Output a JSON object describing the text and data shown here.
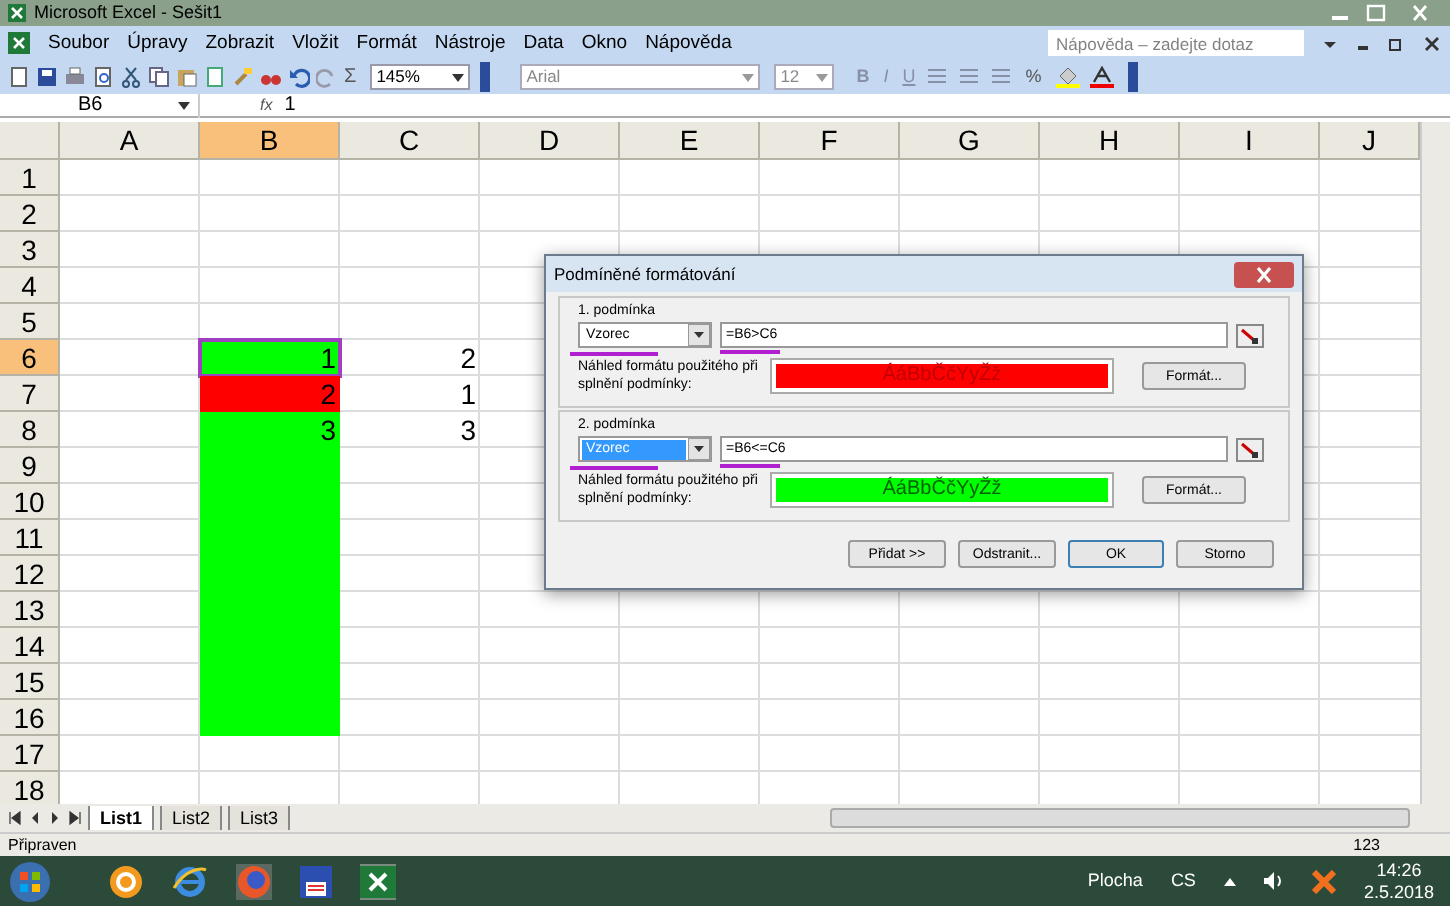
{
  "window": {
    "title": "Microsoft Excel - Sešit1"
  },
  "menu": [
    "Soubor",
    "Úpravy",
    "Zobrazit",
    "Vložit",
    "Formát",
    "Nástroje",
    "Data",
    "Okno",
    "Nápověda"
  ],
  "help_box": {
    "placeholder": "Nápověda – zadejte dotaz"
  },
  "toolbar": {
    "zoom": "145%",
    "font": "Arial",
    "font_size": "12",
    "sum": "Σ",
    "bold": "B",
    "italic": "I",
    "underline": "U",
    "percent": "%"
  },
  "formula_bar": {
    "name_box": "B6",
    "fx": "fx",
    "value": "1"
  },
  "columns": [
    {
      "label": "A",
      "selected": false
    },
    {
      "label": "B",
      "selected": true
    },
    {
      "label": "C",
      "selected": false
    },
    {
      "label": "D",
      "selected": false
    },
    {
      "label": "E",
      "selected": false
    },
    {
      "label": "F",
      "selected": false
    },
    {
      "label": "G",
      "selected": false
    },
    {
      "label": "H",
      "selected": false
    },
    {
      "label": "I",
      "selected": false
    },
    {
      "label": "J",
      "selected": false
    }
  ],
  "rows": [
    {
      "label": "1",
      "selected": false,
      "cells": []
    },
    {
      "label": "2",
      "selected": false,
      "cells": []
    },
    {
      "label": "3",
      "selected": false,
      "cells": []
    },
    {
      "label": "4",
      "selected": false,
      "cells": []
    },
    {
      "label": "5",
      "selected": false,
      "cells": []
    },
    {
      "label": "6",
      "selected": true,
      "cells": [
        {},
        {
          "value": "1",
          "color": "#00ff00",
          "selected": true
        },
        {
          "value": "2"
        }
      ]
    },
    {
      "label": "7",
      "selected": false,
      "cells": [
        {},
        {
          "value": "2",
          "color": "#ff0000"
        },
        {
          "value": "1"
        }
      ]
    },
    {
      "label": "8",
      "selected": false,
      "cells": [
        {},
        {
          "value": "3",
          "color": "#00ff00"
        },
        {
          "value": "3"
        }
      ]
    },
    {
      "label": "9",
      "selected": false,
      "cells": [
        {},
        {
          "color": "#00ff00"
        }
      ]
    },
    {
      "label": "10",
      "selected": false,
      "cells": [
        {},
        {
          "color": "#00ff00"
        }
      ]
    },
    {
      "label": "11",
      "selected": false,
      "cells": [
        {},
        {
          "color": "#00ff00"
        }
      ]
    },
    {
      "label": "12",
      "selected": false,
      "cells": [
        {},
        {
          "color": "#00ff00"
        }
      ]
    },
    {
      "label": "13",
      "selected": false,
      "cells": [
        {},
        {
          "color": "#00ff00"
        }
      ]
    },
    {
      "label": "14",
      "selected": false,
      "cells": [
        {},
        {
          "color": "#00ff00"
        }
      ]
    },
    {
      "label": "15",
      "selected": false,
      "cells": [
        {},
        {
          "color": "#00ff00"
        }
      ]
    },
    {
      "label": "16",
      "selected": false,
      "cells": [
        {},
        {
          "color": "#00ff00"
        }
      ]
    },
    {
      "label": "17",
      "selected": false,
      "cells": []
    },
    {
      "label": "18",
      "selected": false,
      "cells": []
    }
  ],
  "dialog": {
    "title": "Podmíněné formátování",
    "conditions": [
      {
        "label": "1. podmínka",
        "type": "Vzorec",
        "type_selected": false,
        "formula": "=B6>C6",
        "underlined": true,
        "preview_label": "Náhled formátu použitého při splnění podmínky:",
        "preview_text": "ÁáBbČčYyŽž",
        "color": "#ff0000",
        "format_button": "Formát..."
      },
      {
        "label": "2. podmínka",
        "type": "Vzorec",
        "type_selected": true,
        "formula": "=B6<=C6",
        "underlined": true,
        "preview_label": "Náhled formátu použitého při splnění podmínky:",
        "preview_text": "ÁáBbČčYyŽž",
        "color": "#00ff00",
        "format_button": "Formát..."
      }
    ],
    "buttons": [
      "Přidat >>",
      "Odstranit...",
      "OK",
      "Storno"
    ]
  },
  "sheet_tabs": [
    {
      "label": "List1",
      "selected": true
    },
    {
      "label": "List2",
      "selected": false
    },
    {
      "label": "List3",
      "selected": false
    }
  ],
  "status_bar": {
    "status": "Připraven",
    "indicator": "123"
  },
  "taskbar": {
    "desktop": "Plocha",
    "language": "CS",
    "time": "14:26",
    "date": "2.5.2018"
  }
}
